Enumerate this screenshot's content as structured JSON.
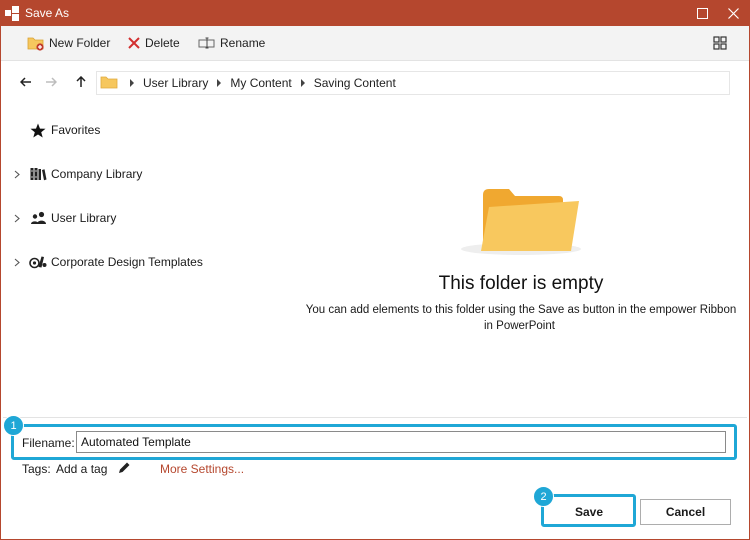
{
  "window": {
    "title": "Save As",
    "accent": "#b5472e",
    "highlight_color": "#1fa7d6"
  },
  "toolbar": {
    "new_folder": "New Folder",
    "delete": "Delete",
    "rename": "Rename",
    "view_icon": "grid-view-icon"
  },
  "breadcrumb": [
    "User Library",
    "My Content",
    "Saving Content"
  ],
  "tree": [
    {
      "label": "Favorites",
      "icon": "star-icon",
      "expandable": false
    },
    {
      "label": "Company Library",
      "icon": "books-icon",
      "expandable": true
    },
    {
      "label": "User Library",
      "icon": "users-icon",
      "expandable": true
    },
    {
      "label": "Corporate Design Templates",
      "icon": "design-templates-icon",
      "expandable": true
    }
  ],
  "empty": {
    "title": "This folder is empty",
    "line1": "You can add elements to this folder using the Save as button in the empower Ribbon",
    "line2": "in PowerPoint"
  },
  "form": {
    "filename_label": "Filename:",
    "filename_value": "Automated Template",
    "tags_label": "Tags:",
    "add_tag": "Add a tag",
    "more_settings": "More Settings..."
  },
  "buttons": {
    "save": "Save",
    "cancel": "Cancel"
  },
  "badges": {
    "one": "1",
    "two": "2"
  }
}
